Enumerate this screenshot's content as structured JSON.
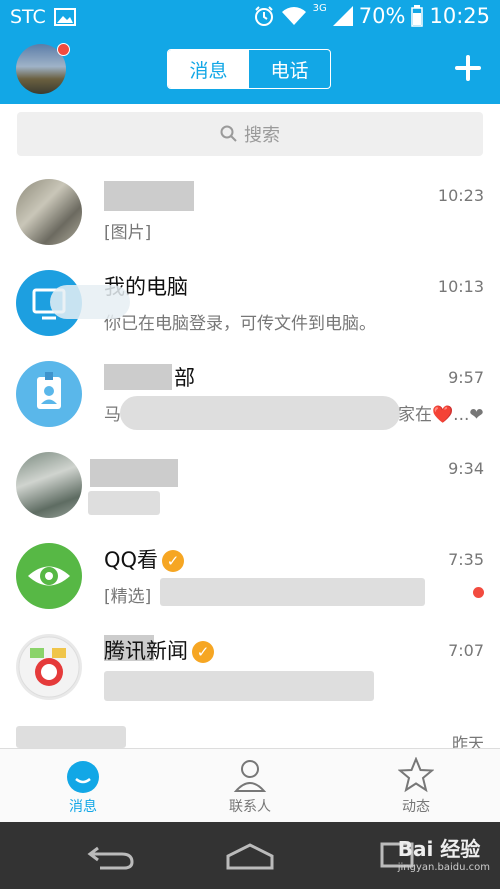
{
  "status_bar": {
    "carrier": "STC",
    "network": "3G",
    "battery": "70%",
    "time": "10:25"
  },
  "header": {
    "tabs": [
      {
        "label": "消息",
        "active": true
      },
      {
        "label": "电话",
        "active": false
      }
    ],
    "add_icon": "plus-icon"
  },
  "search": {
    "placeholder": "搜索"
  },
  "conversations": [
    {
      "name": "",
      "message": "[图片]",
      "time": "10:23"
    },
    {
      "name": "我的电脑",
      "message": "你已在电脑登录，可传文件到电脑。",
      "time": "10:13"
    },
    {
      "name": "部",
      "message": "马",
      "message_tail": "家在❤️...❤",
      "time": "9:57"
    },
    {
      "name": "",
      "message": "",
      "time": "9:34"
    },
    {
      "name": "QQ看",
      "message": "[精选]",
      "time": "7:35",
      "unread_dot": true
    },
    {
      "name": "腾讯新闻",
      "message": "",
      "time": "7:07"
    },
    {
      "name": "",
      "message": "",
      "time": "昨天"
    }
  ],
  "tabbar": {
    "items": [
      {
        "label": "消息",
        "icon": "chat-bubble-icon",
        "active": true
      },
      {
        "label": "联系人",
        "icon": "person-icon",
        "active": false
      },
      {
        "label": "动态",
        "icon": "star-icon",
        "active": false
      }
    ]
  },
  "watermark": {
    "brand": "Bai 经验",
    "url": "jingyan.baidu.com"
  },
  "colors": {
    "accent": "#12a7e6",
    "unread": "#f24b3f",
    "verified": "#f6a623"
  }
}
